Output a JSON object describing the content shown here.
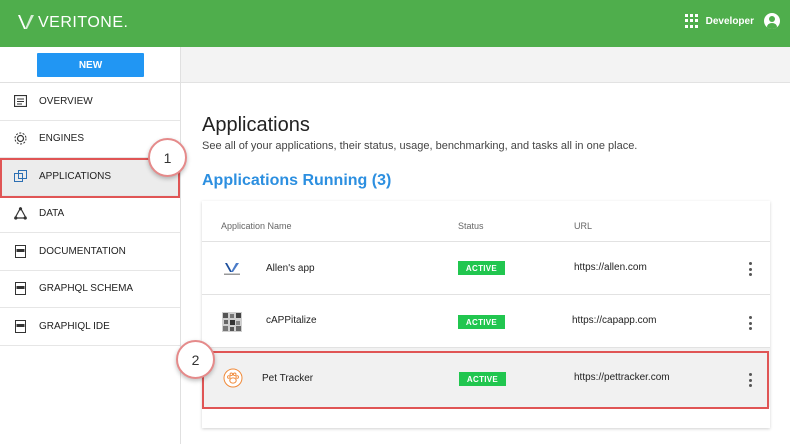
{
  "header": {
    "logo_text": "VERITONE.",
    "user_label": "Developer",
    "brand_color": "#4fae4c"
  },
  "sidebar": {
    "new_button": "NEW",
    "items": [
      {
        "label": "OVERVIEW",
        "icon": "overview-icon"
      },
      {
        "label": "ENGINES",
        "icon": "engines-gear-icon"
      },
      {
        "label": "APPLICATIONS",
        "icon": "applications-icon",
        "active": true
      },
      {
        "label": "DATA",
        "icon": "data-share-icon"
      },
      {
        "label": "DOCUMENTATION",
        "icon": "html-doc-icon"
      },
      {
        "label": "GRAPHQL SCHEMA",
        "icon": "html-doc-icon"
      },
      {
        "label": "GRAPHIQL IDE",
        "icon": "html-doc-icon"
      }
    ]
  },
  "main": {
    "title": "Applications",
    "subtitle": "See all of your applications, their status, usage, benchmarking, and tasks all in one place.",
    "section_title": "Applications Running (3)",
    "table": {
      "headers": [
        "Application Name",
        "Status",
        "URL"
      ],
      "rows": [
        {
          "name": "Allen's app",
          "status": "ACTIVE",
          "url": "https://allen.com",
          "icon": "veritone-logo-icon"
        },
        {
          "name": "cAPPitalize",
          "status": "ACTIVE",
          "url": "https://capapp.com",
          "icon": "capitalize-app-icon"
        },
        {
          "name": "Pet Tracker",
          "status": "ACTIVE",
          "url": "https://pettracker.com",
          "icon": "paw-icon"
        }
      ]
    }
  },
  "callouts": [
    "1",
    "2"
  ],
  "colors": {
    "accent": "#2196f3",
    "active_badge": "#21c64f",
    "callout_border": "#e05555"
  }
}
